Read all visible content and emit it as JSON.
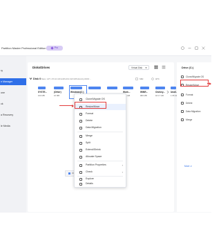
{
  "window": {
    "app_title": "Partition Master Professional Edition",
    "pro_badge": "Pro"
  },
  "sidebar": {
    "items": [
      {
        "label": "ry"
      },
      {
        "label": "n Manager",
        "active": true
      },
      {
        "label": "one"
      },
      {
        "label": "ck"
      },
      {
        "label": "a Recovery"
      },
      {
        "label": "le Media"
      }
    ]
  },
  "main": {
    "title": "Disks/Drives",
    "view_select": "Virtual Disk",
    "disk": {
      "label": "Disk 0",
      "info": "Basic, GPT, 476.94 GB,SAMSUNG MZVLB512HAJQ-00000 ...",
      "stat1": "SSD",
      "stat2": "40°C"
    },
    "partitions": [
      {
        "name": "SYSTE...",
        "size": "100 MB",
        "fill": 0.6
      },
      {
        "name": "(Other)",
        "size": "16 MB",
        "fill": 0.8
      },
      {
        "name": "Windows(C:)",
        "size": "",
        "fill": 0.75,
        "selected": true
      },
      {
        "name": "",
        "size": "",
        "fill": 0.9
      },
      {
        "name": "",
        "size": "",
        "fill": 0.85
      },
      {
        "name": "Work...",
        "size": "8.26 GB",
        "fill": 0.85
      },
      {
        "name": "WINR...",
        "size": "980 MB",
        "fill": 0.7
      },
      {
        "name": "Onekey...",
        "size": "18.17 GB",
        "fill": 0.8
      },
      {
        "name": "Unall...",
        "size": "1.95 GB",
        "fill": 0.7
      }
    ],
    "legend": "Primary"
  },
  "context_menu": {
    "items": [
      {
        "label": "Clone/Migrate OS"
      },
      {
        "label": "Resize/Move",
        "highlighted": true
      },
      {
        "label": "Format"
      },
      {
        "label": "Delete"
      },
      {
        "label": "Data Migration"
      },
      {
        "label": "Merge"
      },
      {
        "label": "Split"
      },
      {
        "label": "Extend/Shrink"
      },
      {
        "label": "Allocate Space"
      },
      {
        "label": "Partition Properties",
        "submenu": true
      },
      {
        "label": "Check",
        "submenu": true
      },
      {
        "label": "Explore"
      },
      {
        "label": "Details"
      }
    ]
  },
  "right_panel": {
    "title": "Drive (C:)",
    "items": [
      {
        "label": "Clone/Migrate OS"
      },
      {
        "label": "Resize/Move"
      },
      {
        "label": "Format"
      },
      {
        "label": "Delete"
      },
      {
        "label": "Data Migration"
      },
      {
        "label": "Merge"
      }
    ],
    "more": "More ∨"
  },
  "colors": {
    "accent": "#2f6fe8",
    "bar": "#4d85f0",
    "annotation": "#e23b3b"
  }
}
